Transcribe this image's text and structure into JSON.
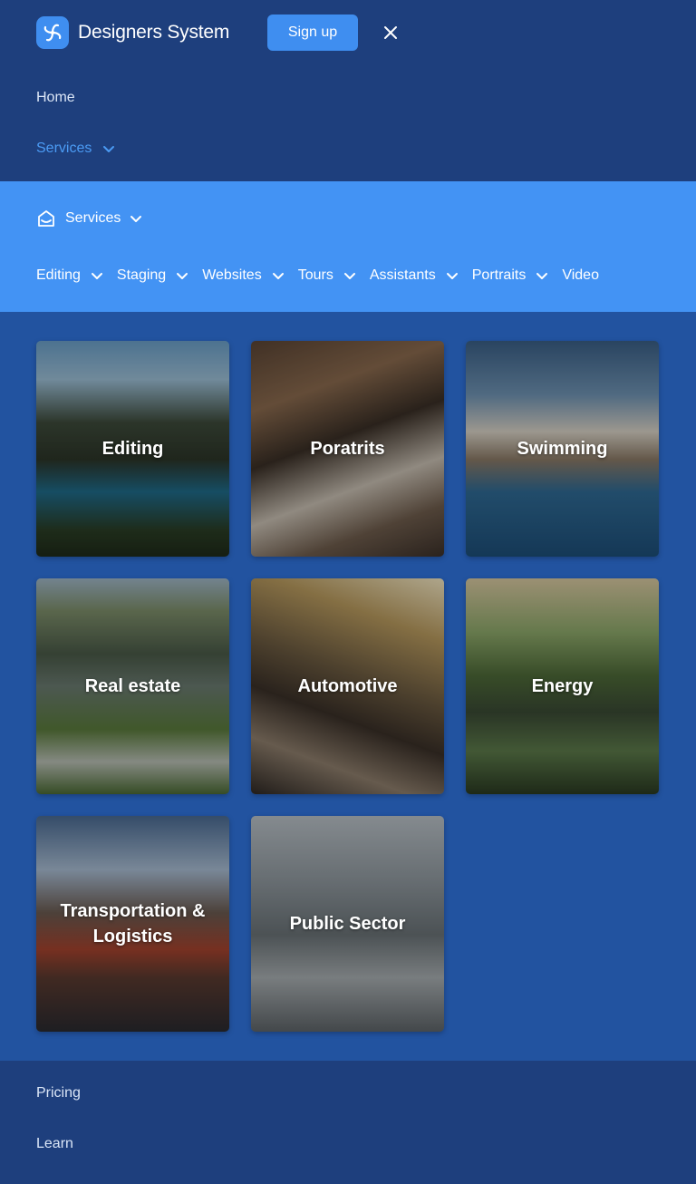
{
  "brand": {
    "name": "Designers System"
  },
  "header": {
    "signup_label": "Sign up"
  },
  "menu": {
    "home": "Home",
    "services": "Services",
    "pricing": "Pricing",
    "learn": "Learn"
  },
  "subnav": {
    "title": "Services",
    "categories": [
      {
        "label": "Editing"
      },
      {
        "label": "Staging"
      },
      {
        "label": "Websites"
      },
      {
        "label": "Tours"
      },
      {
        "label": "Assistants"
      },
      {
        "label": "Portraits"
      },
      {
        "label": "Video"
      }
    ]
  },
  "cards": [
    {
      "title": "Editing"
    },
    {
      "title": "Poratrits"
    },
    {
      "title": "Swimming"
    },
    {
      "title": "Real estate"
    },
    {
      "title": "Automotive"
    },
    {
      "title": "Energy"
    },
    {
      "title": "Transportation & Logistics"
    },
    {
      "title": "Public Sector"
    }
  ],
  "colors": {
    "header_bg": "#1e3f7d",
    "subnav_bg": "#4393f4",
    "grid_bg": "#2253a0",
    "accent": "#3f8ef0",
    "active_link": "#4b9bf4"
  },
  "icons": {
    "logo": "flower-logo-icon",
    "close": "close-icon",
    "services": "house-icon",
    "chevron": "chevron-down-icon"
  }
}
